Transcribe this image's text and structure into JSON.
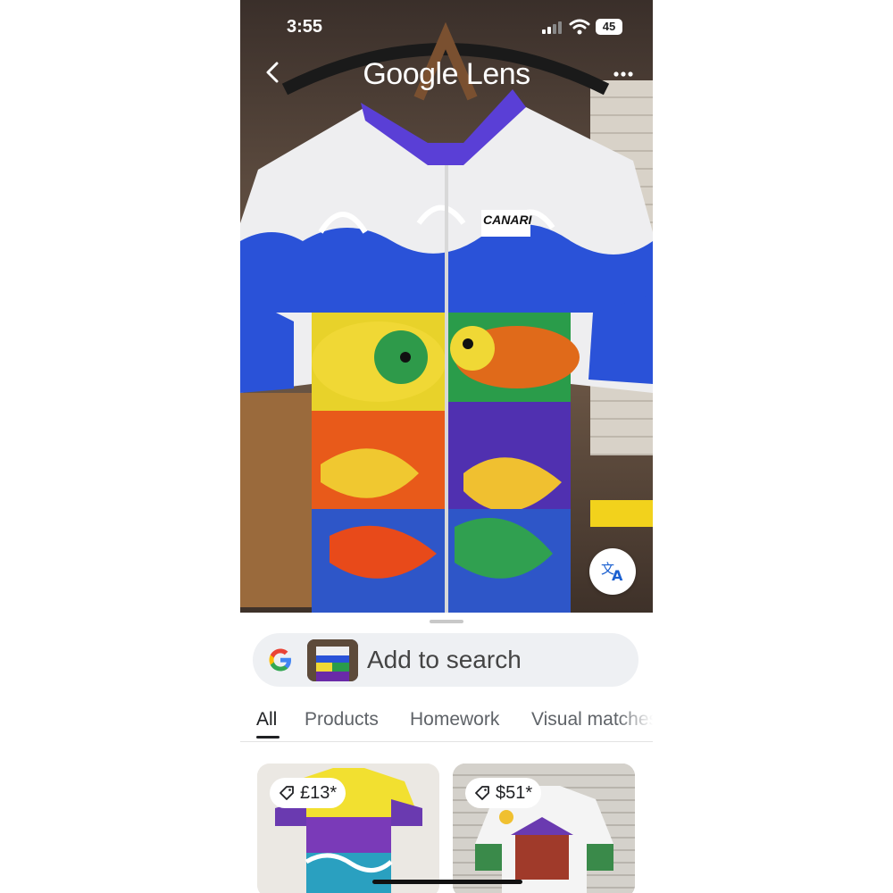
{
  "status_bar": {
    "time": "3:55",
    "battery": "45"
  },
  "appbar": {
    "title": "Google Lens",
    "back_icon": "chevron-left-icon",
    "more_icon": "more-horizontal-icon"
  },
  "photo": {
    "brand_label": "CANARI"
  },
  "search": {
    "label": "Add to search",
    "logo_icon": "google-g-icon"
  },
  "tabs": [
    {
      "label": "All",
      "active": true
    },
    {
      "label": "Products",
      "active": false
    },
    {
      "label": "Homework",
      "active": false
    },
    {
      "label": "Visual matches",
      "active": false
    }
  ],
  "results": [
    {
      "price": "£13*"
    },
    {
      "price": "$51*"
    }
  ],
  "colors": {
    "accent": "#202124",
    "google_blue": "#4285F4",
    "google_red": "#EA4335",
    "google_yellow": "#FBBC05",
    "google_green": "#34A853"
  }
}
